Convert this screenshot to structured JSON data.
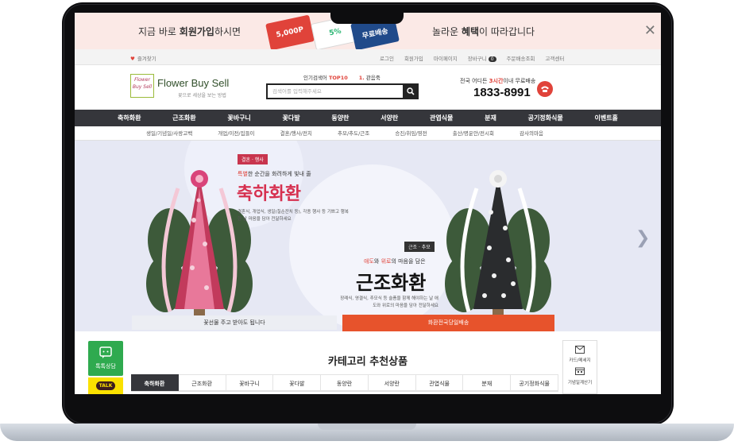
{
  "promo": {
    "left_prefix": "지금 바로 ",
    "left_bold": "회원가입",
    "left_suffix": "하시면",
    "coupon_1": "5,000P",
    "coupon_2": "5%",
    "coupon_3": "무료배송",
    "right_prefix": "놀라운 ",
    "right_bold": "혜택",
    "right_suffix": "이 따라갑니다"
  },
  "utility": {
    "bookmark": "즐겨찾기",
    "links": [
      "로그인",
      "회원가입",
      "마이페이지",
      "장바구니",
      "주문배송조회",
      "고객센터"
    ],
    "cart_count": "0"
  },
  "header": {
    "logo_box": "Flower Buy Sell",
    "logo_name": "Flower Buy Sell",
    "logo_sub": "꽃으로 세상을 보는 방법",
    "popular_label": "인기검색어 ",
    "popular_top": "TOP10",
    "popular_rank_num": "1.",
    "popular_rank_text": "관음죽",
    "search_placeholder": "검색어를 입력해주세요",
    "phone_prefix": "전국 어디든 ",
    "phone_red": "3시간",
    "phone_suffix": "이내 무료배송",
    "phone_number": "1833-8991"
  },
  "nav": {
    "items": [
      "축하화환",
      "근조화환",
      "꽃바구니",
      "꽃다발",
      "동양란",
      "서양란",
      "관엽식물",
      "분재",
      "공기정화식물",
      "이벤트홀"
    ],
    "sub_items": [
      "생일/기념일/사랑고백",
      "개업/이전/집들이",
      "결혼/행사/전치",
      "추모/추도/근조",
      "승진/취임/영전",
      "출산/명운안/전시회",
      "감사의마음"
    ]
  },
  "hero": {
    "tag_1": "결혼 · 행사",
    "sub_1_red": "특별",
    "sub_1_rest": "한 순간을 화려하게 빛내 줄",
    "title_1": "축하화환",
    "desc_1": "결혼식, 개업식, 생일(칠순잔치 등), 각종 행사 등 기쁘고 행복한 날 마음을 담아 전달하세요",
    "tag_2": "근조 · 추모",
    "sub_2_red1": "애도",
    "sub_2_mid": "와 ",
    "sub_2_red2": "위로",
    "sub_2_rest": "의 마음을 담은",
    "title_2": "근조화환",
    "desc_2": "장례식, 영결식, 추모식 등 슬픔을 함께 해야하는 날 애도와 위로의 마음을 담아 전달하세요",
    "caption_left": "꽃선물 주고 받아도 됩니다",
    "caption_right": "화환전국당일배송"
  },
  "side": {
    "chat_label": "톡톡상담",
    "talk_label": "TALK"
  },
  "category": {
    "title": "카테고리 추천상품",
    "tabs": [
      "축하화환",
      "근조화환",
      "꽃바구니",
      "꽃다발",
      "동양란",
      "서양란",
      "관엽식물",
      "분재",
      "공기정화식물"
    ]
  },
  "right_panel": {
    "item_1": "카드/메세지",
    "item_2": "기념일계산기"
  },
  "colors": {
    "accent_red": "#e0433a",
    "nav_dark": "#35363b",
    "hero_bg": "#e6e8f4",
    "kakao_yellow": "#fae100",
    "chat_green": "#2faa4f"
  }
}
